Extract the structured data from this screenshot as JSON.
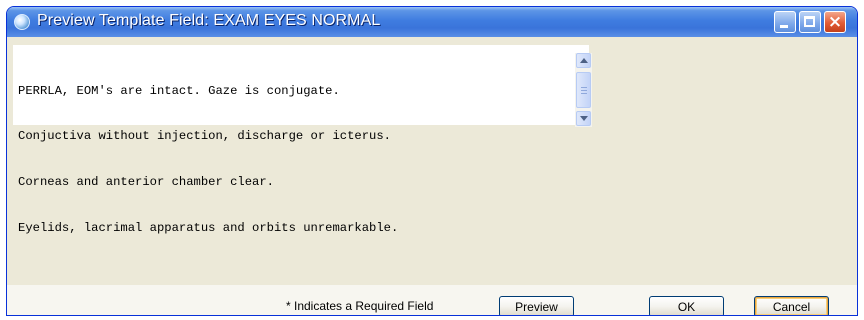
{
  "window": {
    "title": "Preview Template Field: EXAM EYES NORMAL"
  },
  "preview_text": {
    "lines": [
      "PERRLA, EOM's are intact. Gaze is conjugate.",
      "Conjuctiva without injection, discharge or icterus.",
      "Corneas and anterior chamber clear.",
      "Eyelids, lacrimal apparatus and orbits unremarkable."
    ]
  },
  "footer": {
    "required_note": "* Indicates a Required Field",
    "preview_label": "Preview",
    "ok_label": "OK",
    "cancel_label": "Cancel"
  },
  "icons": {
    "app": "app-icon",
    "minimize": "minimize-icon",
    "maximize": "maximize-icon",
    "close": "close-icon"
  }
}
